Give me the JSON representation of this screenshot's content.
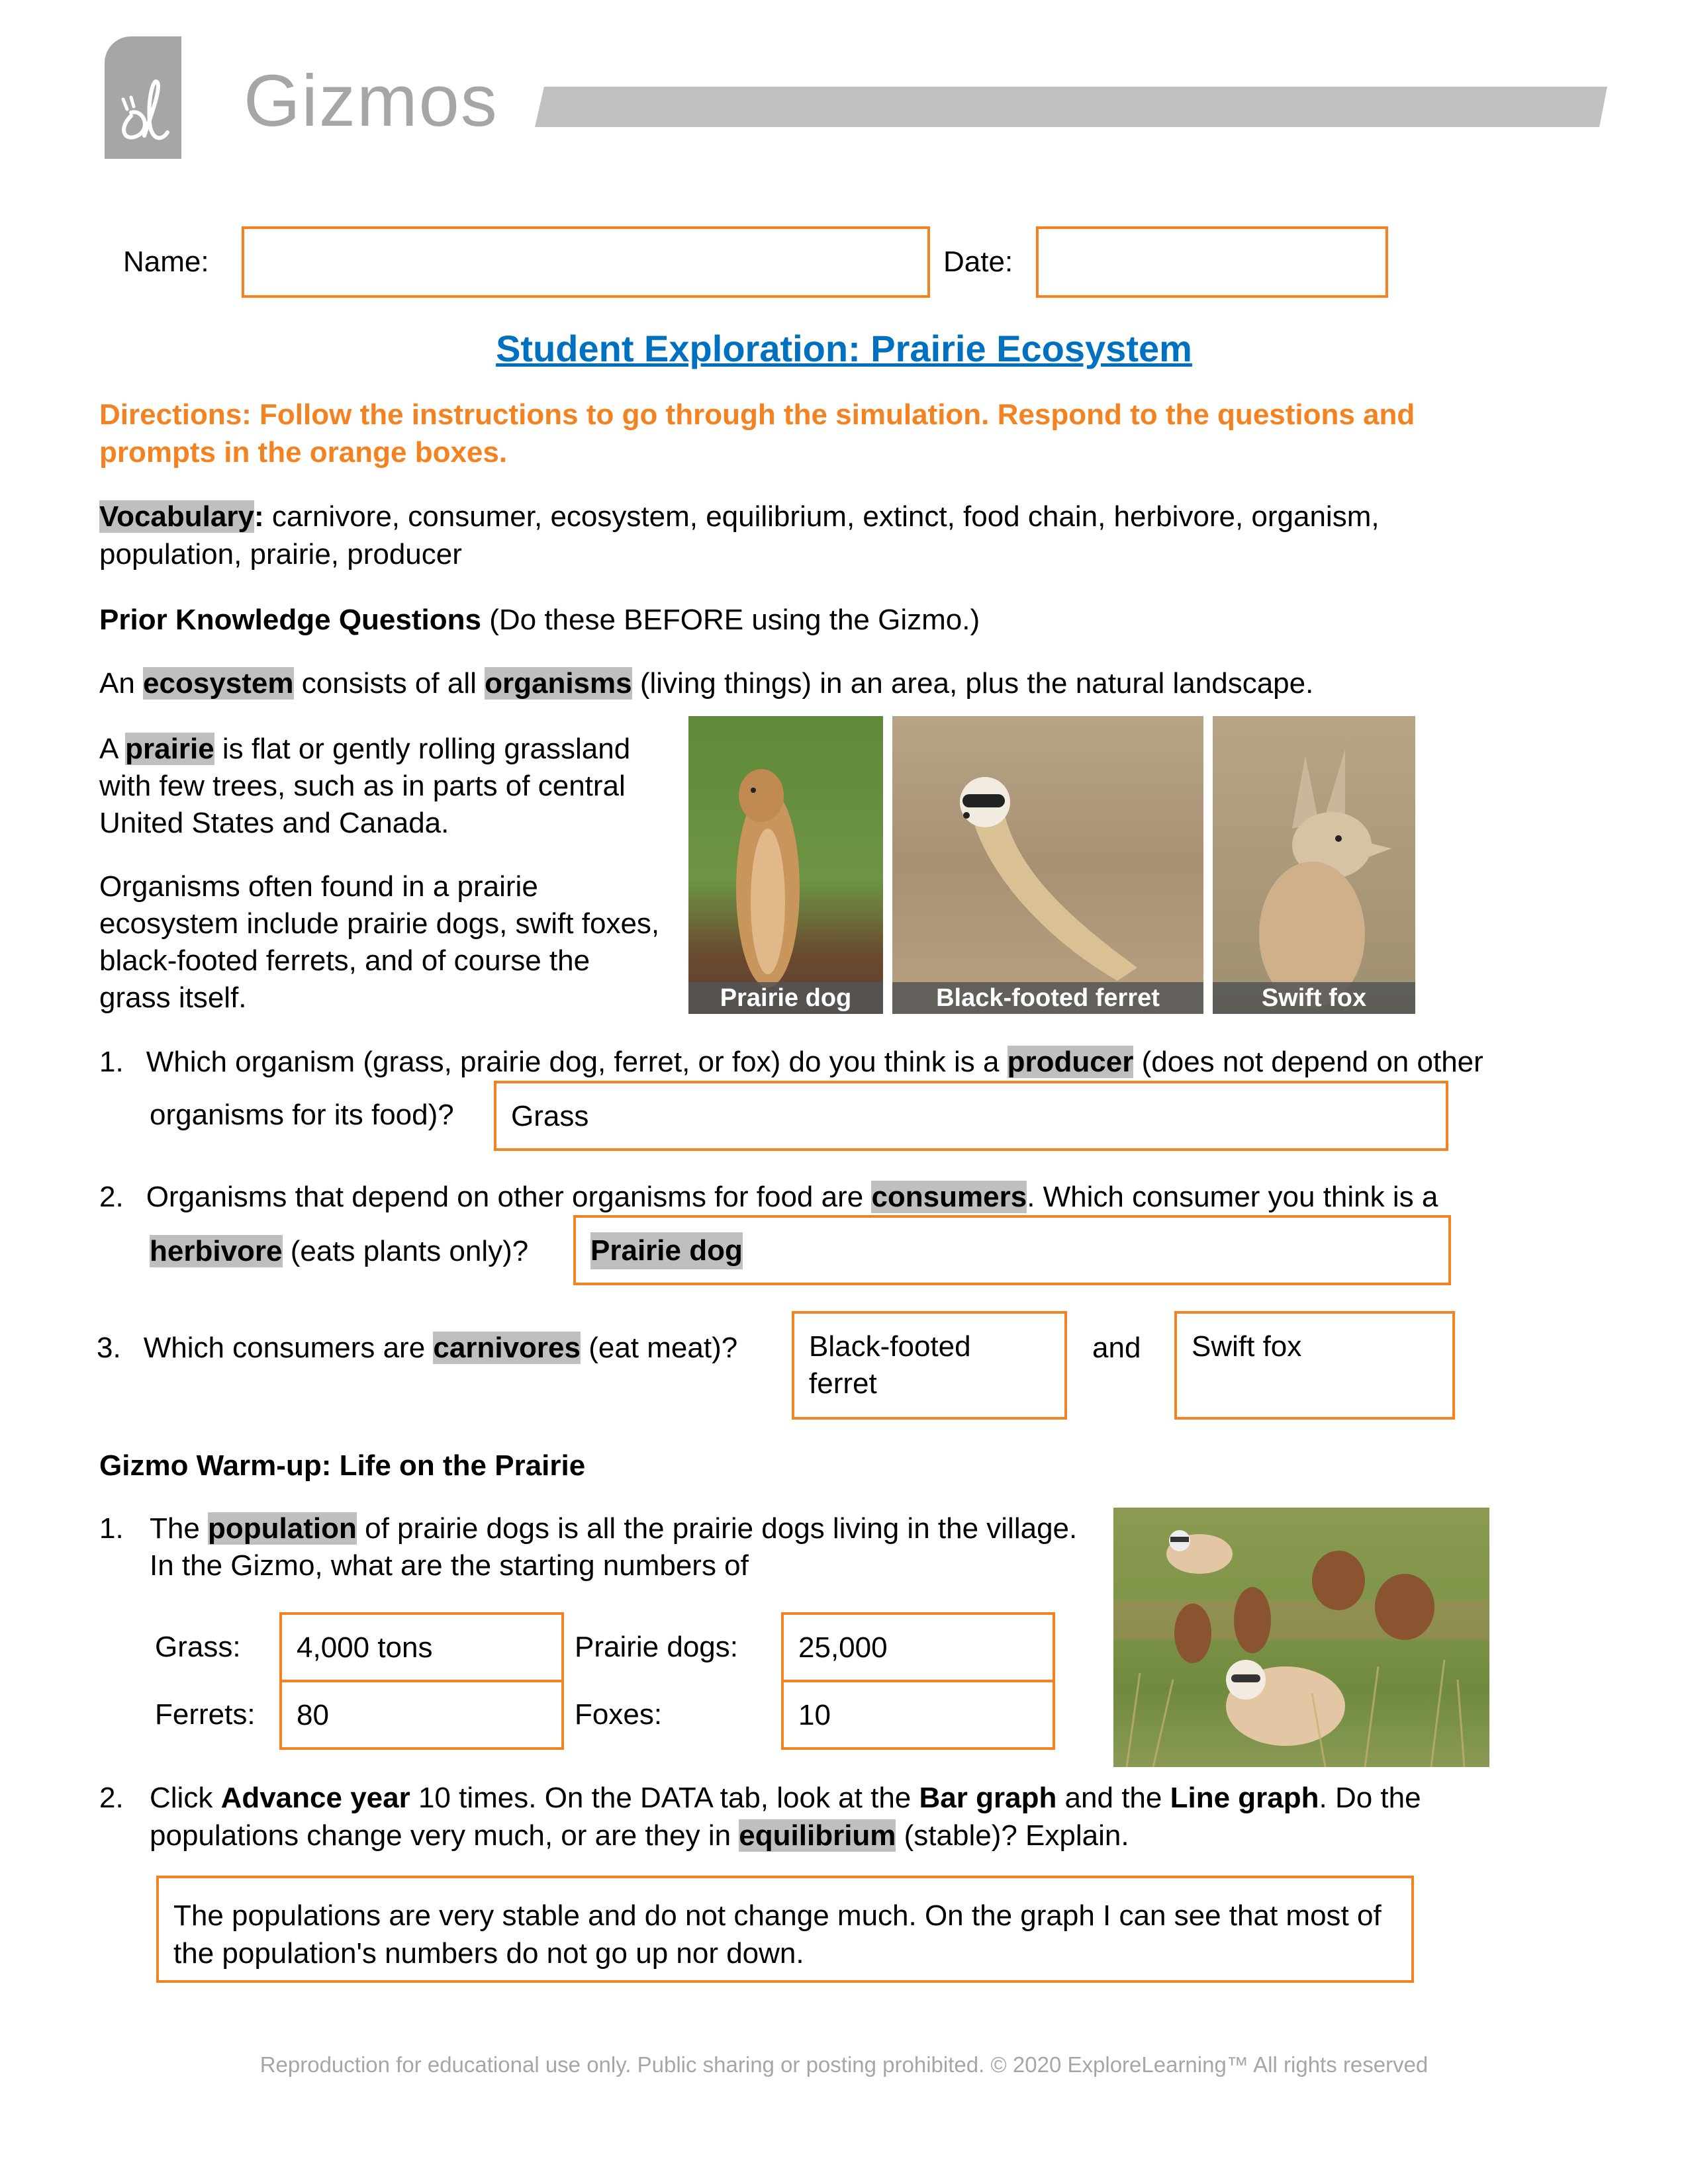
{
  "header": {
    "logo_mark": "ël",
    "logo_text": "Gizmos"
  },
  "form": {
    "name_label": "Name:",
    "name_value": "",
    "date_label": "Date:",
    "date_value": ""
  },
  "title": "Student Exploration: Prairie Ecosystem",
  "directions": "Directions: Follow the instructions to go through the simulation. Respond to the questions and prompts in the orange boxes.",
  "vocabulary": {
    "label": "Vocabulary",
    "colon": ":",
    "terms": " carnivore, consumer, ecosystem, equilibrium, extinct, food chain, herbivore, organism, population, prairie, producer"
  },
  "prior_knowledge": {
    "heading": "Prior Knowledge Questions",
    "note": " (Do these BEFORE using the Gizmo.)",
    "eco_sentence": {
      "p1": "An ",
      "term1": "ecosystem",
      "p2": " consists of all ",
      "term2": "organisms",
      "p3": " (living things) in an area, plus the natural landscape."
    },
    "prairie_sentence": {
      "p1": "A ",
      "term": "prairie",
      "p2": " is flat or gently rolling grassland with few trees, such as in parts of central United States and Canada."
    },
    "organisms_paragraph": "Organisms often found in a prairie ecosystem include prairie dogs, swift foxes, black-footed ferrets, and of course the grass itself.",
    "photos": [
      {
        "caption": "Prairie dog"
      },
      {
        "caption": "Black-footed ferret"
      },
      {
        "caption": "Swift fox"
      }
    ],
    "q1": {
      "number": "1.",
      "p1": "Which organism (grass, prairie dog, ferret, or fox) do you think is a ",
      "term": "producer",
      "p2": " (does not depend on other",
      "p3": "organisms for its food)?",
      "answer": "Grass"
    },
    "q2": {
      "number": "2.",
      "p1": "Organisms that depend on other organisms for food are ",
      "term1": "consumers",
      "p2": ". Which consumer you think is a",
      "term2": "herbivore",
      "p3": " (eats plants only)?",
      "answer": "Prairie dog"
    },
    "q3": {
      "number": "3.",
      "p1": "Which consumers are ",
      "term": "carnivores",
      "p2": " (eat meat)?",
      "answer1": "Black-footed ferret",
      "and_label": "and",
      "answer2": "Swift fox"
    }
  },
  "warmup": {
    "heading": "Gizmo Warm-up: Life on the Prairie",
    "q1": {
      "number": "1.",
      "p1": "The ",
      "term": "population",
      "p2": " of prairie dogs is all the prairie dogs living in the village. In the Gizmo, what are the starting numbers of",
      "grass_label": "Grass:",
      "grass_value": "4,000 tons",
      "dogs_label": "Prairie dogs:",
      "dogs_value": "25,000",
      "ferrets_label": "Ferrets:",
      "ferrets_value": "80",
      "foxes_label": "Foxes:",
      "foxes_value": "10"
    },
    "q2": {
      "number": "2.",
      "p1": "Click ",
      "b1": "Advance year",
      "p2": " 10 times. On the DATA tab, look at the ",
      "b2": "Bar graph",
      "p3": " and the ",
      "b3": "Line graph",
      "p4": ". Do the populations change very much, or are they in ",
      "term": "equilibrium",
      "p5": " (stable)? Explain.",
      "answer": "The populations are very stable and do not change much. On the graph I can see that most of the population's numbers do not go up nor down."
    }
  },
  "footer": "Reproduction for educational use only. Public sharing or posting prohibited. © 2020 ExploreLearning™ All rights reserved",
  "colors": {
    "accent_orange": "#F58220",
    "title_blue": "#0070C0",
    "highlight_grey": "#BFBFBF",
    "logo_grey": "#A6A6A6"
  }
}
